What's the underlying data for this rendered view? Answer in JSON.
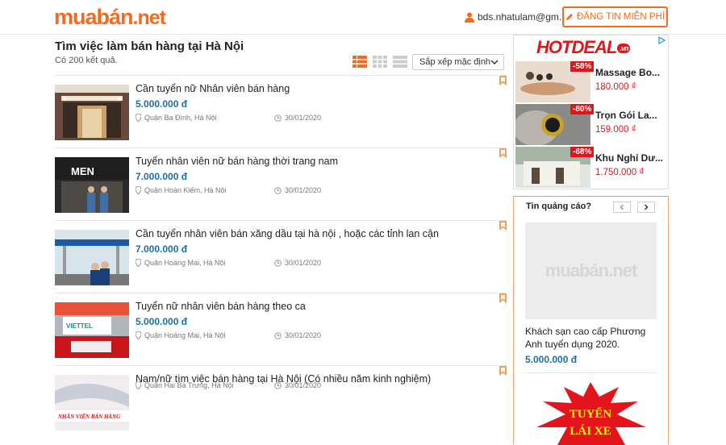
{
  "header": {
    "logo_main": "muabán",
    "logo_suffix": ".net",
    "user": "bds.nhatulam@gm...",
    "post_button": "ĐĂNG TIN MIỄN PHÍ"
  },
  "main": {
    "title": "Tìm việc làm bán hàng tại Hà Nội",
    "count": "Có 200 kết quả.",
    "sort": "Sắp xếp mặc định",
    "listings": [
      {
        "title": "Cần tuyển nữ Nhân viên bán hàng",
        "price": "5.000.000 đ",
        "location": "Quận Ba Đình, Hà Nội",
        "date": "30/01/2020"
      },
      {
        "title": "Tuyển nhân viên nữ bán hàng thời trang nam",
        "price": "7.000.000 đ",
        "location": "Quận Hoàn Kiếm, Hà Nội",
        "date": "30/01/2020"
      },
      {
        "title": "Cần tuyển nhân viên bán xăng dầu tại hà nội , hoặc các tỉnh lan cận",
        "price": "7.000.000 đ",
        "location": "Quận Hoàng Mai, Hà Nội",
        "date": "30/01/2020"
      },
      {
        "title": "Tuyển nữ nhân viên bán hàng theo ca",
        "price": "5.000.000 đ",
        "location": "Quận Hoàng Mai, Hà Nội",
        "date": "30/01/2020"
      },
      {
        "title": "Nam/nữ tìm việc bán hàng tại Hà Nội (Có nhiều năm kinh nghiệm)",
        "price": "",
        "location": "Quận Hai Bà Trưng, Hà Nội",
        "date": "30/01/2020"
      }
    ],
    "thumb_texts": {
      "men": "MEN",
      "viettel": "VIETTEL",
      "banner": "NHÂN VIÊN BÁN HÀNG"
    }
  },
  "hotdeal": {
    "logo": "HOTDEAL",
    "logo_badge": ".vn",
    "deals": [
      {
        "discount": "-58%",
        "name": "Massage Bo...",
        "price": "180.000 ₫"
      },
      {
        "discount": "-80%",
        "name": "Trọn Gói La...",
        "price": "159.000 ₫"
      },
      {
        "discount": "-68%",
        "name": "Khu Nghỉ Dư...",
        "price": "1.750.000 ₫"
      }
    ]
  },
  "ad": {
    "heading": "Tin quảng cáo?",
    "placeholder_logo": "muabán.net",
    "text": "Khách sạn cao cấp Phương Anh tuyển dụng 2020.",
    "price": "5.000.000 đ",
    "banner_line1": "TUYỂN",
    "banner_line2": "LÁI XE"
  },
  "colors": {
    "brand": "#f26b21",
    "price_blue": "#1b6ea8",
    "hotdeal_red": "#e3141b"
  }
}
